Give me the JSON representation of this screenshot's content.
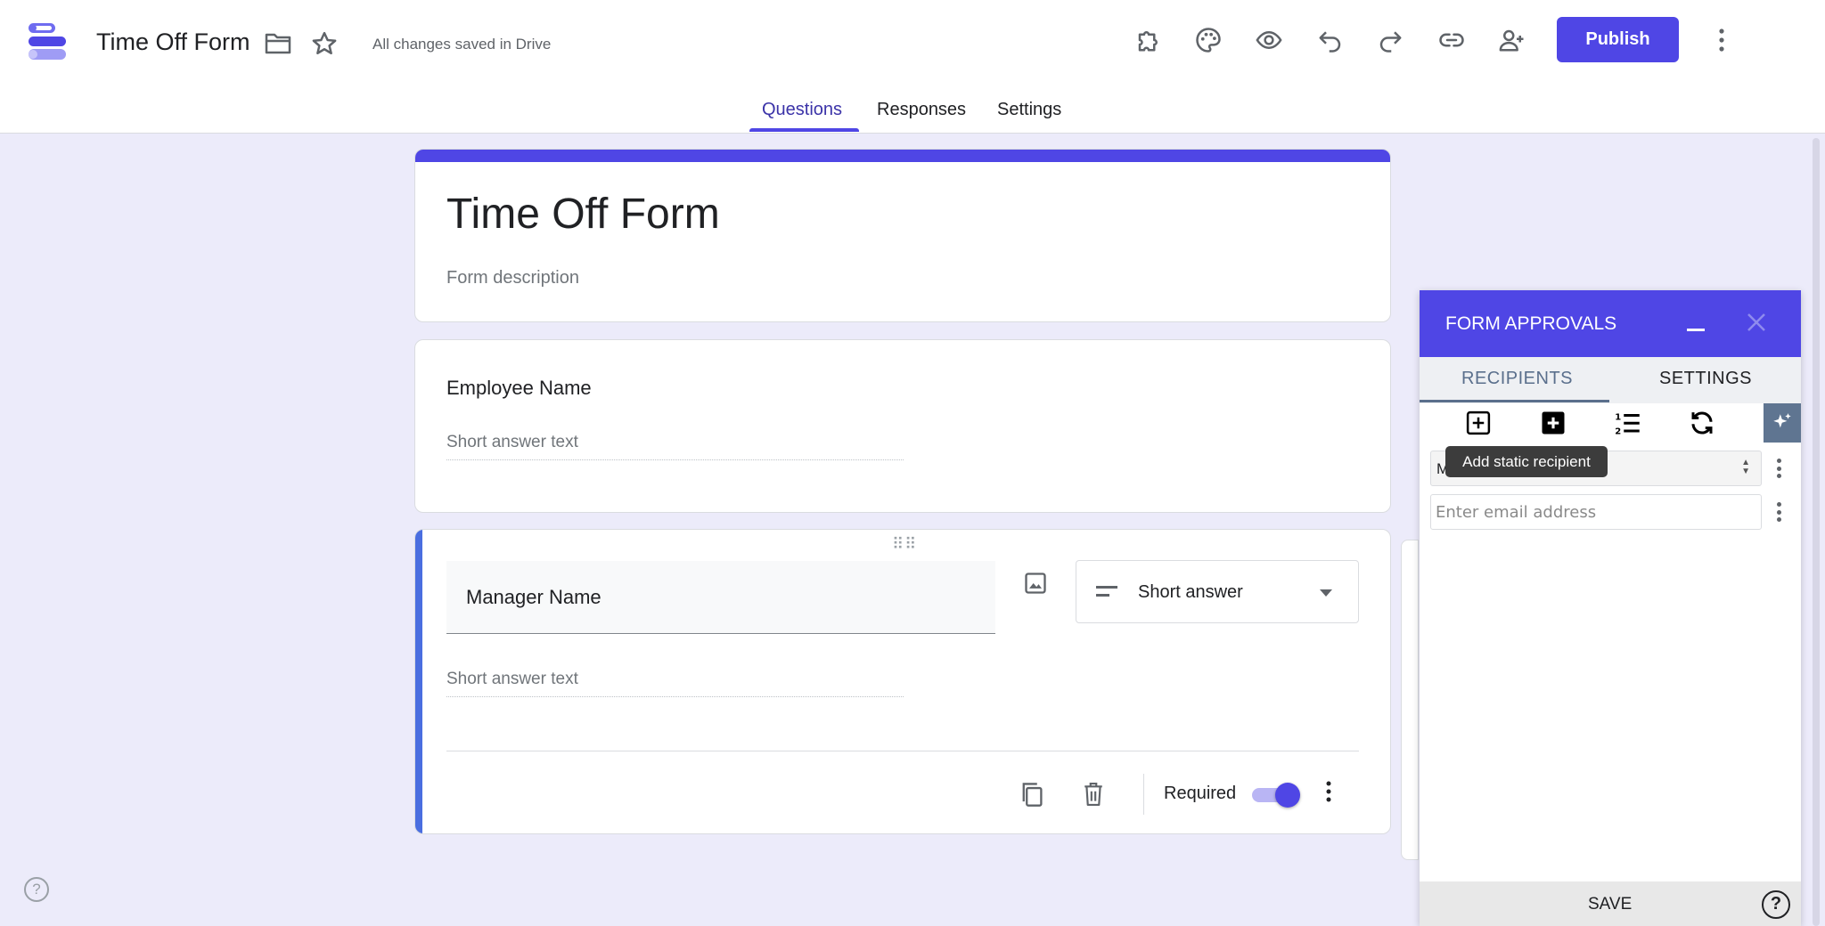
{
  "header": {
    "doc_title": "Time Off Form",
    "saved_status": "All changes saved in Drive",
    "publish_label": "Publish",
    "icons": [
      "addon-icon",
      "palette-icon",
      "preview-eye-icon",
      "undo-icon",
      "redo-icon",
      "link-icon",
      "add-collaborator-icon",
      "more-vert-icon"
    ]
  },
  "tabs": [
    {
      "label": "Questions",
      "active": true
    },
    {
      "label": "Responses",
      "active": false
    },
    {
      "label": "Settings",
      "active": false
    }
  ],
  "form": {
    "title": "Time Off Form",
    "description_placeholder": "Form description",
    "questions": [
      {
        "title": "Employee Name",
        "answer_placeholder": "Short answer text"
      },
      {
        "title": "Manager Name",
        "answer_placeholder": "Short answer text",
        "type": "Short answer",
        "required_label": "Required",
        "required": true
      }
    ]
  },
  "approvals": {
    "title": "FORM APPROVALS",
    "tabs": [
      "RECIPIENTS",
      "SETTINGS"
    ],
    "tooltip": "Add static recipient",
    "select_value": "M",
    "email_placeholder": "Enter email address",
    "save_label": "SAVE",
    "help_label": "?"
  },
  "colors": {
    "accent": "#4f46e5",
    "background": "#ecebfa",
    "panel_tab": "#5a6f8c"
  }
}
